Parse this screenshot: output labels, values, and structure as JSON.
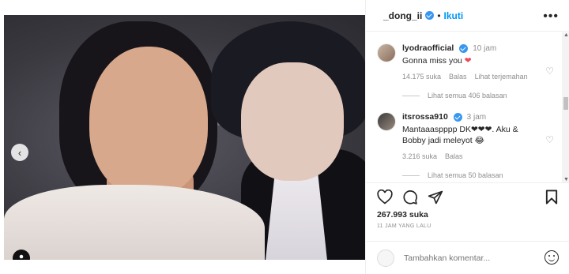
{
  "header": {
    "username": "_dong_ii",
    "separator": "•",
    "follow_label": "Ikuti",
    "more_icon": "more-horizontal-icon"
  },
  "comments": [
    {
      "username": "lyodraofficial",
      "time": "10 jam",
      "text": "Gonna miss you",
      "emoji": "❤",
      "likes": "14.175 suka",
      "reply_label": "Balas",
      "translate_label": "Lihat terjemahan",
      "view_replies": "Lihat semua 406 balasan"
    },
    {
      "username": "itsrossa910",
      "time": "3 jam",
      "text": "Mantaaaspppp DK❤❤❤. Aku & Bobby jadi meleyot 😂",
      "likes": "3.216 suka",
      "reply_label": "Balas",
      "view_replies": "Lihat semua 50 balasan"
    }
  ],
  "actions": {
    "like_icon": "heart-icon",
    "comment_icon": "comment-icon",
    "share_icon": "paper-plane-icon",
    "save_icon": "bookmark-icon"
  },
  "likes_total": "267.993 suka",
  "posted": "11 JAM YANG LALU",
  "add_comment": {
    "placeholder": "Tambahkan komentar..."
  },
  "carousel": {
    "slides": 5,
    "active_index": 3
  },
  "colors": {
    "accent": "#0095f6",
    "verified": "#3897f0",
    "heart": "#ed4956",
    "muted": "#8e8e8e"
  }
}
